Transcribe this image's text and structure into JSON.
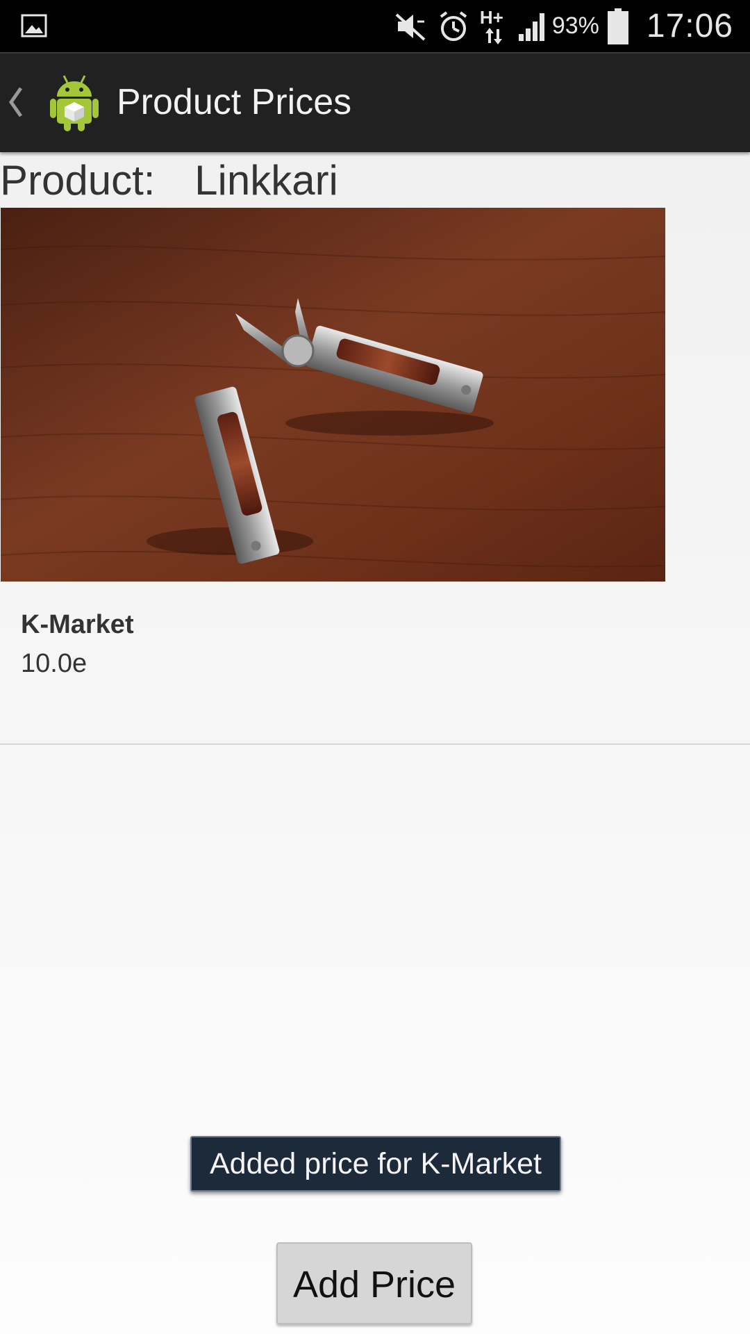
{
  "status_bar": {
    "battery_percent": "93%",
    "time": "17:06",
    "network_label": "H+",
    "icons": [
      "gallery-icon",
      "mute-icon",
      "alarm-icon",
      "network-hplus-icon",
      "signal-icon",
      "battery-icon"
    ]
  },
  "action_bar": {
    "title": "Product Prices",
    "back_icon": "chevron-left-icon",
    "app_icon": "android-icon"
  },
  "product": {
    "label": "Product:",
    "name": "Linkkari"
  },
  "prices": [
    {
      "store": "K-Market",
      "price": "10.0e"
    }
  ],
  "toast": {
    "message": "Added price for K-Market"
  },
  "buttons": {
    "add_price_label": "Add Price"
  },
  "colors": {
    "status_bar_bg": "#000000",
    "action_bar_bg": "#212121",
    "toast_bg": "#1d2a3a",
    "button_bg": "#d6d6d6",
    "android_green": "#a4c639"
  }
}
